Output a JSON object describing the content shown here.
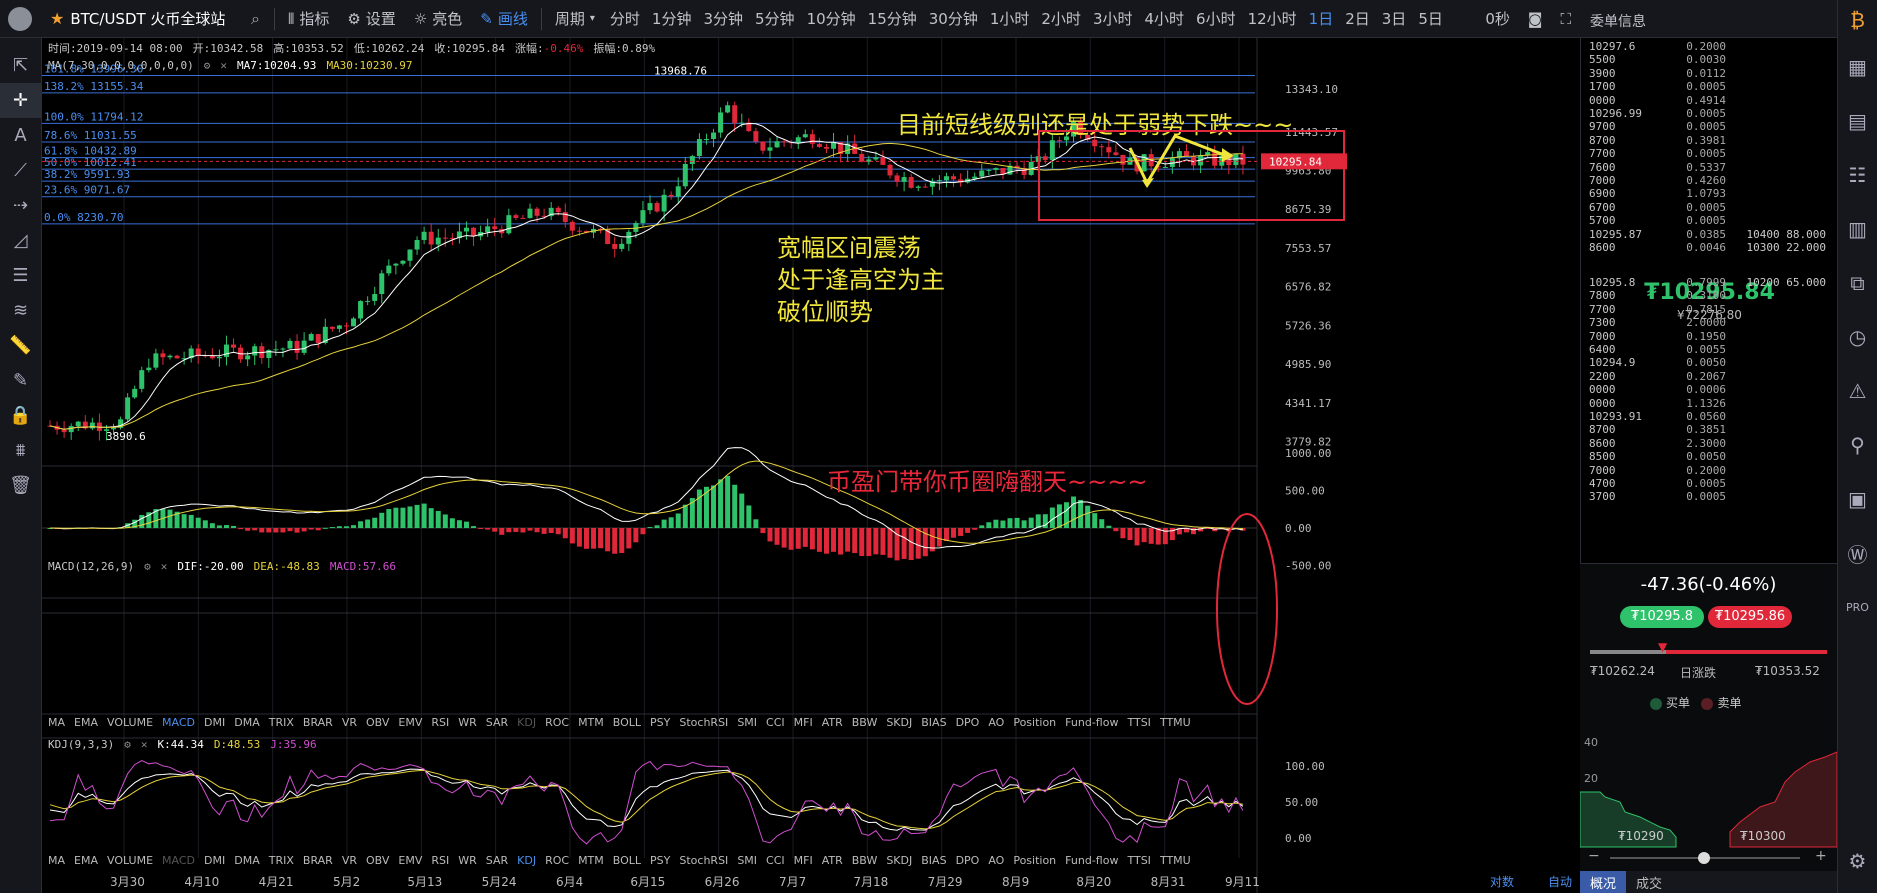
{
  "toolbar": {
    "pair": "BTC/USDT 火币全球站",
    "indicator": "指标",
    "settings": "设置",
    "theme": "亮色",
    "draw": "画线",
    "period": "周期",
    "intervals": [
      "分时",
      "1分钟",
      "3分钟",
      "5分钟",
      "10分钟",
      "15分钟",
      "30分钟",
      "1小时",
      "2小时",
      "3小时",
      "4小时",
      "6小时",
      "12小时",
      "1日",
      "2日",
      "3日",
      "5日"
    ],
    "active_interval": "1日",
    "countdown": "0秒"
  },
  "panel_title": "委单信息",
  "info": {
    "time": "时间:2019-09-14 08:00",
    "open": "开:10342.58",
    "high": "高:10353.52",
    "low": "低:10262.24",
    "close": "收:10295.84",
    "change_label": "涨幅:",
    "change": "-0.46%",
    "amplitude": "振幅:0.89%",
    "ma": "MA(7,30,0,0,0,0,0,0,0)",
    "ma7": "MA7:10204.93",
    "ma30": "MA30:10230.97"
  },
  "fib_levels": [
    {
      "label": "161.8% 13996.30",
      "price": 13996.3
    },
    {
      "label": "138.2% 13155.34",
      "price": 13155.34
    },
    {
      "label": "100.0% 11794.12",
      "price": 11794.12
    },
    {
      "label": "78.6% 11031.55",
      "price": 11031.55
    },
    {
      "label": "61.8% 10432.89",
      "price": 10432.89
    },
    {
      "label": "50.0% 10012.41",
      "price": 10012.41
    },
    {
      "label": "38.2% 9591.93",
      "price": 9591.93
    },
    {
      "label": "23.6% 9071.67",
      "price": 9071.67
    },
    {
      "label": "0.0% 8230.70",
      "price": 8230.7
    }
  ],
  "price_axis": [
    "13343.10",
    "11443.57",
    "9963.80",
    "8675.39",
    "7553.57",
    "6576.82",
    "5726.36",
    "4985.90",
    "4341.17",
    "3779.82"
  ],
  "current_price_tag": "10295.84",
  "high_marker": "13968.76",
  "low_marker": "3890.6",
  "annotations": {
    "top": "目前短线级别还是处于弱势下跌~~~",
    "mid1": "宽幅区间震荡",
    "mid2": "处于逢高空为主",
    "mid3": "破位顺势",
    "bottom": "币盈门带你币圈嗨翻天~~~~"
  },
  "macd": {
    "label": "MACD(12,26,9)",
    "dif": "DIF:-20.00",
    "dea": "DEA:-48.83",
    "macd": "MACD:57.66",
    "axis": [
      "1000.00",
      "500.00",
      "0.00",
      "-500.00"
    ]
  },
  "kdj": {
    "label": "KDJ(9,3,3)",
    "k": "K:44.34",
    "d": "D:48.53",
    "j": "J:35.96",
    "axis": [
      "100.00",
      "50.00",
      "0.00"
    ]
  },
  "indicator_tabs": [
    "MA",
    "EMA",
    "VOLUME",
    "MACD",
    "DMI",
    "DMA",
    "TRIX",
    "BRAR",
    "VR",
    "OBV",
    "EMV",
    "RSI",
    "WR",
    "SAR",
    "KDJ",
    "ROC",
    "MTM",
    "BOLL",
    "PSY",
    "StochRSI",
    "SMI",
    "CCI",
    "MFI",
    "ATR",
    "BBW",
    "SKDJ",
    "BIAS",
    "DPO",
    "AO",
    "Position",
    "Fund-flow",
    "TTSI",
    "TTMU"
  ],
  "dates": [
    "3月30",
    "4月10",
    "4月21",
    "5月2",
    "5月13",
    "5月24",
    "6月4",
    "6月15",
    "6月26",
    "7月7",
    "7月18",
    "7月29",
    "8月9",
    "8月20",
    "8月31",
    "9月11"
  ],
  "bottom_right": [
    "对数",
    "自动"
  ],
  "orderbook": {
    "asks": [
      [
        "10297.6",
        "0.2000",
        ""
      ],
      [
        "5500",
        "0.0030",
        ""
      ],
      [
        "3900",
        "0.0112",
        ""
      ],
      [
        "1700",
        "0.0005",
        ""
      ],
      [
        "0000",
        "0.4914",
        ""
      ],
      [
        "10296.99",
        "0.0005",
        ""
      ],
      [
        "9700",
        "0.0005",
        ""
      ],
      [
        "8700",
        "0.3981",
        ""
      ],
      [
        "7700",
        "0.0005",
        ""
      ],
      [
        "7600",
        "0.5337",
        ""
      ],
      [
        "7000",
        "0.4260",
        ""
      ],
      [
        "6900",
        "1.0793",
        ""
      ],
      [
        "6700",
        "0.0005",
        ""
      ],
      [
        "5700",
        "0.0005",
        ""
      ],
      [
        "10295.87",
        "0.0385",
        "10400  88.000"
      ],
      [
        "8600",
        "0.0046",
        "10300  22.000"
      ]
    ],
    "last": "₮10295.84",
    "last_cny": "¥72276.80",
    "bids": [
      [
        "10295.8",
        "0.7999",
        "10200  65.000"
      ],
      [
        "7800",
        "0.3100",
        ""
      ],
      [
        "7700",
        "0.7815",
        ""
      ],
      [
        "7300",
        "2.0000",
        ""
      ],
      [
        "7000",
        "0.1950",
        ""
      ],
      [
        "6400",
        "0.0055",
        ""
      ],
      [
        "10294.9",
        "0.0050",
        ""
      ],
      [
        "2200",
        "0.2067",
        ""
      ],
      [
        "0000",
        "0.0006",
        ""
      ],
      [
        "0000",
        "1.1326",
        ""
      ],
      [
        "10293.91",
        "0.0560",
        ""
      ],
      [
        "8700",
        "0.3851",
        ""
      ],
      [
        "8600",
        "2.3000",
        ""
      ],
      [
        "8500",
        "0.0050",
        ""
      ],
      [
        "7000",
        "0.2000",
        ""
      ],
      [
        "4700",
        "0.0005",
        ""
      ],
      [
        "3700",
        "0.0005",
        ""
      ]
    ]
  },
  "stats": {
    "change": "-47.36(-0.46%)",
    "buy_price": "₮10295.8",
    "sell_price": "₮10295.86",
    "low": "₮10262.24",
    "range_label": "日涨跌",
    "high": "₮10353.52",
    "legend_buy": "买单",
    "legend_sell": "卖单",
    "depth_y": [
      "40",
      "20"
    ],
    "depth_x": [
      "₮10290",
      "₮10300"
    ],
    "minus": "−",
    "plus": "+",
    "tabs": [
      "概况",
      "成交"
    ]
  },
  "colors": {
    "up": "#2ec26a",
    "down": "#e0283a",
    "ma7": "#ffffff",
    "ma30": "#e6d23a",
    "fib": "#3b6fd8",
    "annot": "#f0e63c",
    "annot_red": "#e8283a"
  }
}
